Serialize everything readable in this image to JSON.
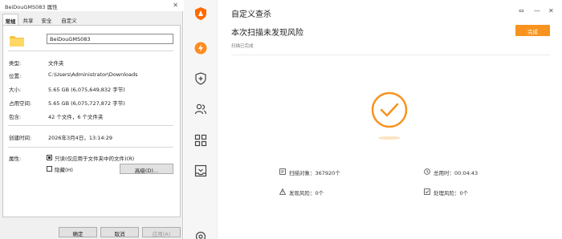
{
  "dialog": {
    "title": "BeiDouGMS083 属性",
    "close_glyph": "✕",
    "tabs": [
      "常规",
      "共享",
      "安全",
      "自定义"
    ],
    "folder_name": "BeiDouGMS083",
    "rows": [
      {
        "label": "类型:",
        "value": "文件夹"
      },
      {
        "label": "位置:",
        "value": "C:\\Users\\Administrator\\Downloads"
      },
      {
        "label": "大小:",
        "value": "5.65 GB (6,075,649,832 字节)"
      },
      {
        "label": "占用空间:",
        "value": "5.65 GB (6,075,727,872 字节)"
      },
      {
        "label": "包含:",
        "value": "42 个文件，6 个文件夹"
      },
      {
        "label": "创建时间:",
        "value": "2026年3月4日，13:14:29"
      }
    ],
    "attributes_label": "属性:",
    "readonly_label": "只读(仅应用于文件夹中的文件)(R)",
    "readonly_checked": true,
    "hidden_label": "隐藏(H)",
    "hidden_checked": false,
    "advanced_button": "高级(D)...",
    "ok_button": "确定",
    "cancel_button": "取消",
    "apply_button": "应用(A)"
  },
  "app": {
    "title": "自定义查杀",
    "main_title": "本次扫描未发现风险",
    "main_subtitle": "扫描已完成",
    "done_button": "完成",
    "window_controls": {
      "menu": "⇔",
      "minimize": "—",
      "close": "✕"
    },
    "stats": [
      {
        "label": "扫描对象：367920个",
        "icon": "document-icon"
      },
      {
        "label": "总用时：00:04:43",
        "icon": "clock-icon"
      },
      {
        "label": "发现风险：0个",
        "icon": "warning-icon"
      },
      {
        "label": "处理风险：0个",
        "icon": "check-box-icon"
      }
    ],
    "rail_icons": [
      "shield-logo-icon",
      "lightning-icon",
      "shield-plus-icon",
      "users-icon",
      "apps-icon",
      "inbox-icon",
      "gear-icon"
    ],
    "colors": {
      "accent": "#f7931e",
      "brand": "#ff6a00"
    }
  }
}
